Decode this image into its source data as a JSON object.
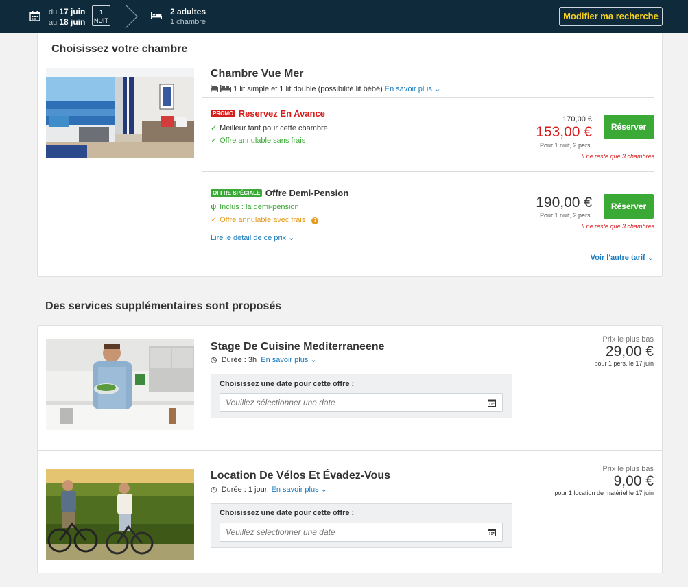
{
  "header": {
    "du": "du",
    "date_from": "17 juin",
    "au": "au",
    "date_to": "18 juin",
    "nights_count": "1",
    "nights_label": "NUIT",
    "guests": "2 adultes",
    "rooms": "1 chambre",
    "modify_button": "Modifier ma recherche"
  },
  "room_section": {
    "heading": "Choisissez votre chambre",
    "room": {
      "title": "Chambre Vue Mer",
      "beds": "1 lit simple et 1 lit double (possibilité lit bébé)",
      "more_link": "En savoir plus"
    },
    "rates": [
      {
        "badge": "PROMO",
        "title": "Reservez En Avance",
        "features": [
          "Meilleur tarif pour cette chambre",
          "Offre annulable sans frais"
        ],
        "old_price": "170,00 €",
        "price": "153,00 €",
        "note": "Pour 1 nuit, 2 pers.",
        "scarcity": "Il ne reste que 3 chambres",
        "button": "Réserver"
      },
      {
        "badge": "OFFRE SPÉCIALE",
        "title": "Offre Demi-Pension",
        "features": [
          "Inclus : la demi-pension",
          "Offre annulable avec frais"
        ],
        "detail_link": "Lire le détail de ce prix",
        "price": "190,00 €",
        "note": "Pour 1 nuit, 2 pers.",
        "scarcity": "Il ne reste que 3 chambres",
        "button": "Réserver"
      }
    ],
    "other_rate_link": "Voir l'autre tarif"
  },
  "services_section": {
    "heading": "Des services supplémentaires sont proposés",
    "items": [
      {
        "title": "Stage De Cuisine Mediterraneene",
        "duration": "Durée : 3h",
        "more_link": "En savoir plus",
        "date_label": "Choisissez une date pour cette offre :",
        "date_placeholder": "Veuillez sélectionner une date",
        "low_label": "Prix le plus bas",
        "price": "29,00 €",
        "note": "pour 1 pers. le 17 juin"
      },
      {
        "title": "Location De Vélos Et Évadez-Vous",
        "duration": "Durée : 1 jour",
        "more_link": "En savoir plus",
        "date_label": "Choisissez une date pour cette offre :",
        "date_placeholder": "Veuillez sélectionner une date",
        "low_label": "Prix le plus bas",
        "price": "9,00 €",
        "note": "pour 1 location de matériel le 17 juin"
      }
    ]
  },
  "colors": {
    "header_bg": "#0f2a3a",
    "accent_yellow": "#f7d21e",
    "green": "#3aa935",
    "red": "#d81b1b",
    "link": "#1a7bbf",
    "orange": "#e69a1c"
  }
}
